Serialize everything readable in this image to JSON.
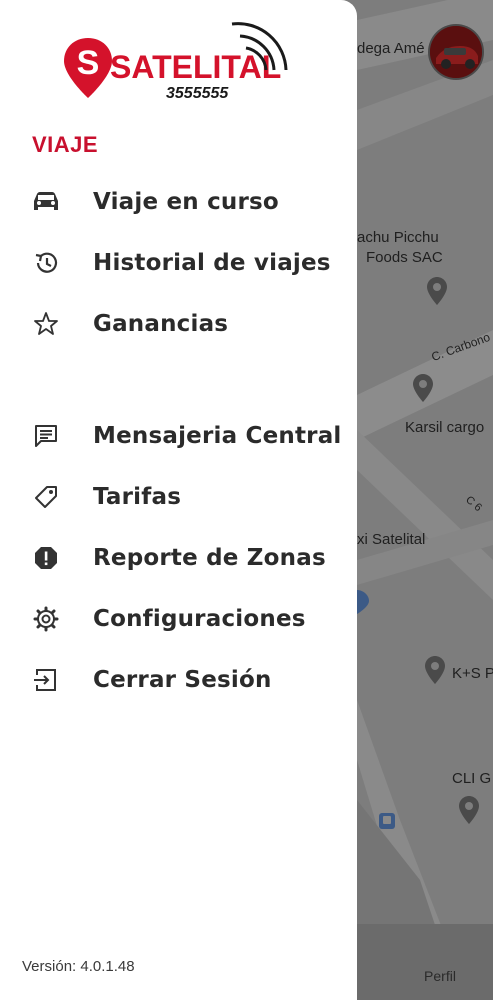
{
  "drawer": {
    "logo_text": "SATELITAL",
    "logo_phone": "3555555",
    "section_title": "VIAJE",
    "items": [
      {
        "label": "Viaje en curso",
        "icon": "car-icon"
      },
      {
        "label": "Historial de viajes",
        "icon": "history-icon"
      },
      {
        "label": "Ganancias",
        "icon": "star-icon"
      },
      {
        "label": "Mensajeria Central",
        "icon": "message-icon"
      },
      {
        "label": "Tarifas",
        "icon": "tag-icon"
      },
      {
        "label": "Reporte de Zonas",
        "icon": "alert-icon"
      },
      {
        "label": "Configuraciones",
        "icon": "gear-icon"
      },
      {
        "label": "Cerrar Sesión",
        "icon": "logout-icon"
      }
    ],
    "version": "Versión: 4.0.1.48"
  },
  "map": {
    "labels": [
      "dega Amé",
      "achu Picchu",
      "Foods SAC",
      "C. Carbono",
      "Karsil cargo",
      "C 6",
      "xi Satelital",
      "K+S P",
      "CLI G"
    ]
  },
  "bottom_nav": {
    "perfil_label": "Perfil"
  },
  "colors": {
    "brand_red": "#c8102e",
    "text_dark": "#2b2b2b",
    "map_overlay": "#7d7d7d"
  }
}
